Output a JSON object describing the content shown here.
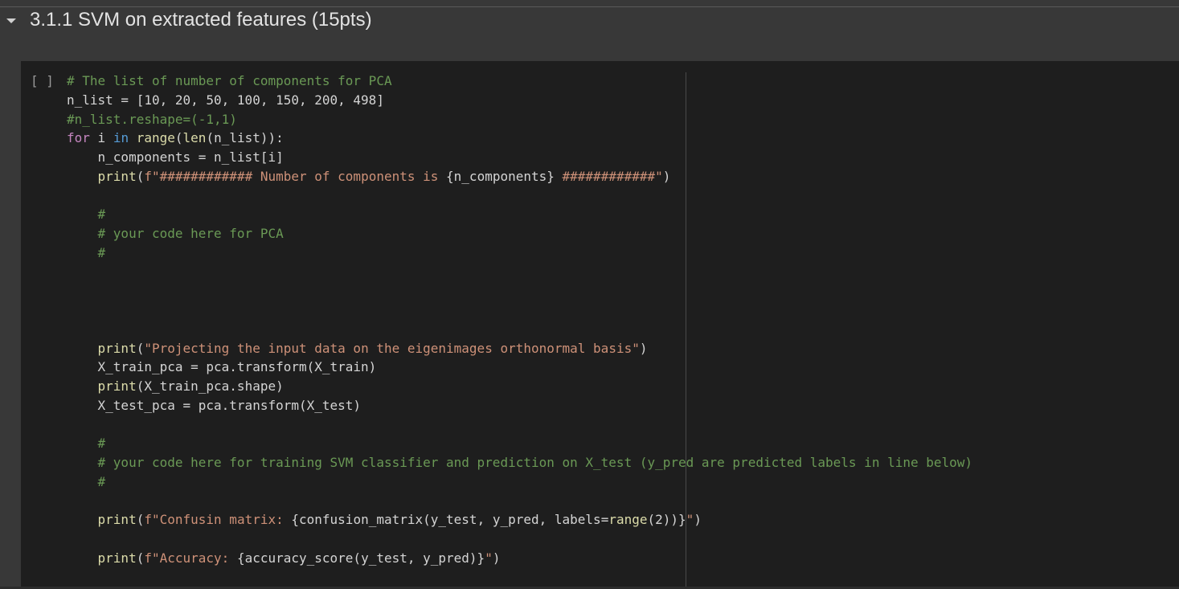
{
  "section": {
    "title": "3.1.1 SVM on extracted features (15pts)",
    "collapse_icon": "chevron-down-icon"
  },
  "cell": {
    "run_indicator": "[ ]",
    "code_lines": [
      [
        {
          "t": "# The list of number of components for PCA",
          "c": "cm"
        }
      ],
      [
        {
          "t": "n_list = [10, 20, 50, 100, 150, 200, 498]"
        }
      ],
      [
        {
          "t": "#n_list.reshape=(-1,1)",
          "c": "cm"
        }
      ],
      [
        {
          "t": "for",
          "c": "kw"
        },
        {
          "t": " i "
        },
        {
          "t": "in",
          "c": "kb"
        },
        {
          "t": " "
        },
        {
          "t": "range",
          "c": "fn"
        },
        {
          "t": "("
        },
        {
          "t": "len",
          "c": "fn"
        },
        {
          "t": "(n_list)):"
        }
      ],
      [
        {
          "t": "    n_components = n_list[i]"
        }
      ],
      [
        {
          "t": "    "
        },
        {
          "t": "print",
          "c": "fn"
        },
        {
          "t": "("
        },
        {
          "t": "f\"############ Number of components is ",
          "c": "st"
        },
        {
          "t": "{n_components}"
        },
        {
          "t": " ############\"",
          "c": "st"
        },
        {
          "t": ")"
        }
      ],
      [],
      [
        {
          "t": "    "
        },
        {
          "t": "#",
          "c": "cm"
        }
      ],
      [
        {
          "t": "    "
        },
        {
          "t": "# your code here for PCA",
          "c": "cm"
        }
      ],
      [
        {
          "t": "    "
        },
        {
          "t": "#",
          "c": "cm"
        }
      ],
      [],
      [],
      [],
      [],
      [
        {
          "t": "    "
        },
        {
          "t": "print",
          "c": "fn"
        },
        {
          "t": "("
        },
        {
          "t": "\"Projecting the input data on the eigenimages orthonormal basis\"",
          "c": "st"
        },
        {
          "t": ")"
        }
      ],
      [
        {
          "t": "    X_train_pca = pca.transform(X_train)"
        }
      ],
      [
        {
          "t": "    "
        },
        {
          "t": "print",
          "c": "fn"
        },
        {
          "t": "(X_train_pca.shape)"
        }
      ],
      [
        {
          "t": "    X_test_pca = pca.transform(X_test)"
        }
      ],
      [],
      [
        {
          "t": "    "
        },
        {
          "t": "#",
          "c": "cm"
        }
      ],
      [
        {
          "t": "    "
        },
        {
          "t": "# your code here for training SVM classifier and prediction on X_test (y_pred are predicted labels in line below)",
          "c": "cm"
        }
      ],
      [
        {
          "t": "    "
        },
        {
          "t": "#",
          "c": "cm"
        }
      ],
      [],
      [
        {
          "t": "    "
        },
        {
          "t": "print",
          "c": "fn"
        },
        {
          "t": "("
        },
        {
          "t": "f\"Confusin matrix: ",
          "c": "st"
        },
        {
          "t": "{confusion_matrix(y_test, y_pred, labels="
        },
        {
          "t": "range",
          "c": "fn"
        },
        {
          "t": "(2))}"
        },
        {
          "t": "\"",
          "c": "st"
        },
        {
          "t": ")"
        }
      ],
      [],
      [
        {
          "t": "    "
        },
        {
          "t": "print",
          "c": "fn"
        },
        {
          "t": "("
        },
        {
          "t": "f\"Accuracy: ",
          "c": "st"
        },
        {
          "t": "{accuracy_score(y_test, y_pred)}"
        },
        {
          "t": "\"",
          "c": "st"
        },
        {
          "t": ")"
        }
      ]
    ]
  }
}
